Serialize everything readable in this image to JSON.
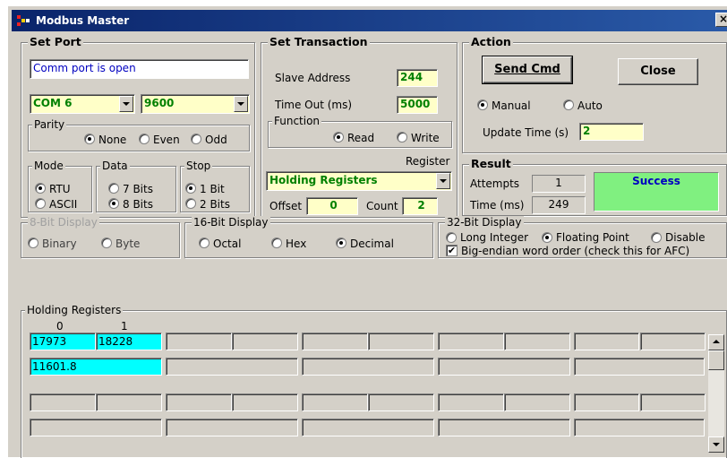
{
  "window": {
    "title": "Modbus Master",
    "close": "×"
  },
  "set_port": {
    "label": "Set Port",
    "status": "Comm port is open",
    "port": "COM 6",
    "baud": "9600",
    "parity": {
      "label": "Parity",
      "options": [
        "None",
        "Even",
        "Odd"
      ],
      "selected": "None"
    },
    "mode": {
      "label": "Mode",
      "options": [
        "RTU",
        "ASCII"
      ],
      "selected": "RTU"
    },
    "data": {
      "label": "Data",
      "options": [
        "7 Bits",
        "8 Bits"
      ],
      "selected": "8 Bits"
    },
    "stop": {
      "label": "Stop",
      "options": [
        "1 Bit",
        "2 Bits"
      ],
      "selected": "1 Bit"
    }
  },
  "transaction": {
    "label": "Set Transaction",
    "slave_label": "Slave Address",
    "slave": "244",
    "timeout_label": "Time Out (ms)",
    "timeout": "5000",
    "function": {
      "label": "Function",
      "options": [
        "Read",
        "Write"
      ],
      "selected": "Read"
    },
    "register_label": "Register",
    "register": "Holding Registers",
    "offset_label": "Offset",
    "offset": "0",
    "count_label": "Count",
    "count": "2"
  },
  "action": {
    "label": "Action",
    "send": "Send Cmd",
    "close": "Close",
    "modes": [
      "Manual",
      "Auto"
    ],
    "selected": "Manual",
    "update_label": "Update Time (s)",
    "update": "2"
  },
  "result": {
    "label": "Result",
    "attempts_label": "Attempts",
    "attempts": "1",
    "time_label": "Time (ms)",
    "time": "249",
    "status": "Success",
    "status_color": "#80f080"
  },
  "display8": {
    "label": "8-Bit Display",
    "options": [
      "Binary",
      "Byte"
    ]
  },
  "display16": {
    "label": "16-Bit Display",
    "options": [
      "Octal",
      "Hex",
      "Decimal"
    ],
    "selected": "Decimal"
  },
  "display32": {
    "label": "32-Bit Display",
    "options": [
      "Long Integer",
      "Floating Point",
      "Disable"
    ],
    "selected": "Floating Point",
    "bigendian": "Big-endian word order (check this for AFC)",
    "bigendian_checked": true
  },
  "registers": {
    "label": "Holding Registers",
    "cols": [
      "0",
      "1"
    ],
    "row1": [
      "17973",
      "18228"
    ],
    "row2": "11601.8",
    "highlight": "#00ffff"
  }
}
